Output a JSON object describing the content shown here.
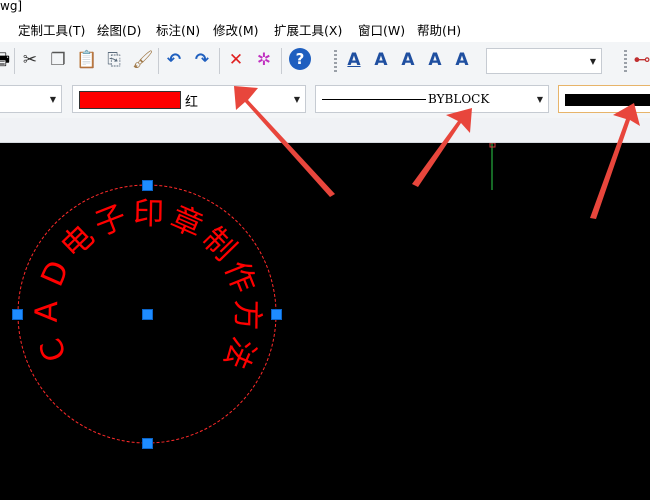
{
  "window": {
    "title_fragment": "wg]"
  },
  "menu": {
    "items": [
      "定制工具(T)",
      "绘图(D)",
      "标注(N)",
      "修改(M)",
      "扩展工具(X)",
      "窗口(W)",
      "帮助(H)"
    ]
  },
  "toolbar": {
    "text_style_icons": [
      "A",
      "A",
      "A",
      "A",
      "A"
    ]
  },
  "properties": {
    "color_label": "红",
    "color_hex": "#ff0000",
    "linetype_label": "BYBLOCK",
    "lineweight_color_hex": "#000000"
  },
  "stamp": {
    "text": "CAD电子印章制作方法",
    "color": "#ff0000",
    "outline_color": "#ff2a2a"
  },
  "colors": {
    "grip": "#1e8cff",
    "annotation_arrow": "#e8463c",
    "axis_green": "#2bd14a",
    "axis_red": "#d03a3a"
  }
}
